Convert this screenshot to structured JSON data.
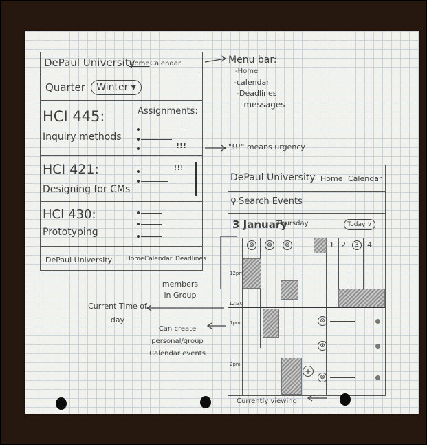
{
  "mobile_sketch": {
    "header": {
      "brand": "DePaul University",
      "home": "Home",
      "calendar": "Calendar"
    },
    "quarter": {
      "label": "Quarter",
      "value": "Winter ▾"
    },
    "assignments_title": "Assignments:",
    "courses": [
      {
        "code": "HCI 445:",
        "name": "Inquiry methods",
        "urgency": "!!!"
      },
      {
        "code": "HCI 421:",
        "name": "Designing for CMs",
        "urgency": "!!!"
      },
      {
        "code": "HCI 430:",
        "name": "Prototyping",
        "urgency": ""
      }
    ],
    "footer": {
      "brand": "DePaul University",
      "home": "Home",
      "calendar": "Calendar",
      "deadlines": "Deadlines"
    }
  },
  "annotations": {
    "menu_bar_title": "Menu bar:",
    "menu_items": [
      "-Home",
      "-calendar",
      "-Deadlines",
      "-messages"
    ],
    "urgency_note": "\"!!!\" means urgency",
    "members": "members in Group",
    "current_time": "Current Time of day",
    "create_events": "Can create personal/group Calendar events",
    "currently_viewing": "Currently viewing"
  },
  "calendar_sketch": {
    "header": {
      "brand": "DePaul University",
      "home": "Home",
      "calendar": "Calendar"
    },
    "search_placeholder": "Search Events",
    "date": "3 January",
    "weekday": "Thursday",
    "today_button": "Today ∨",
    "day_numbers": [
      "1",
      "2",
      "3",
      "4"
    ],
    "times": [
      "12pm",
      "12:30",
      "1pm",
      "2pm"
    ],
    "member_icon": "⊗",
    "add_icon": "+"
  }
}
